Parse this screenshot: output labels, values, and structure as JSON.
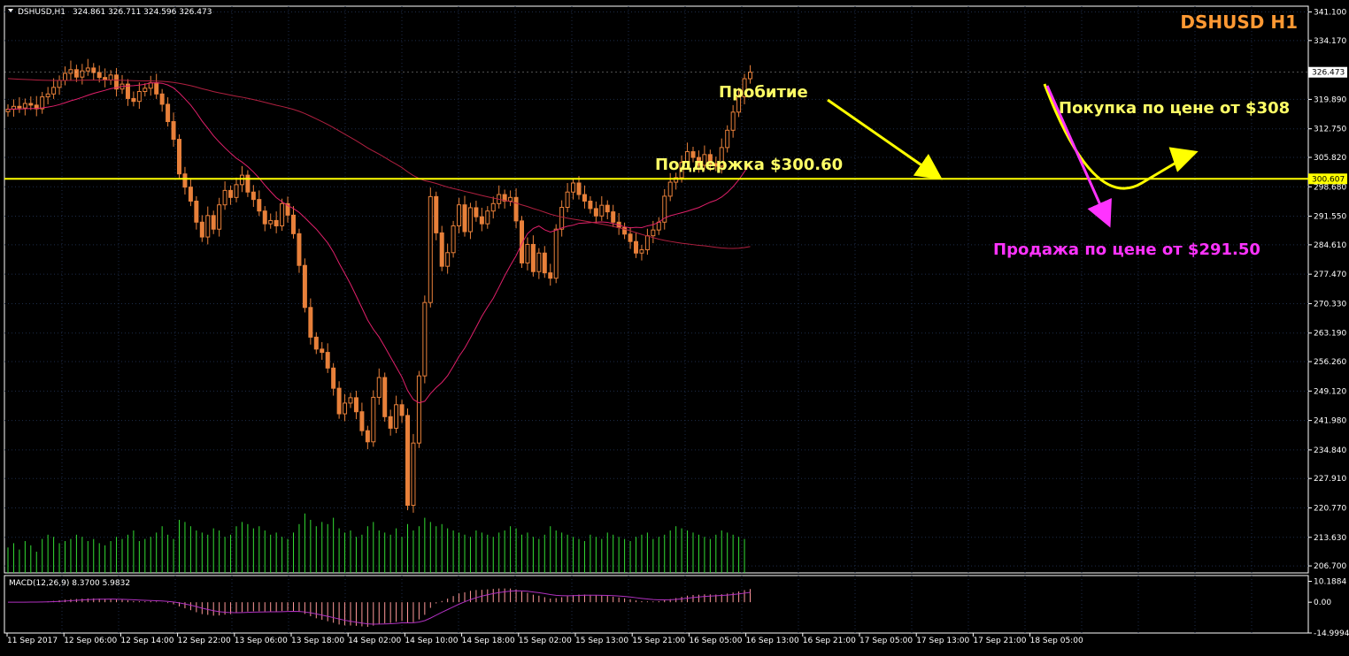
{
  "header": {
    "symbol_caption": "DSHUSD,H1",
    "ohlc": "324.861 326.711 324.596 326.473",
    "chart_title": "DSHUSD H1"
  },
  "colors": {
    "background": "#000000",
    "frame": "#ffffff",
    "grid": "#1e2d4a",
    "candle": "#e8803a",
    "volume": "#33dd33",
    "ma_fast": "#e0206a",
    "ma_slow": "#b02040",
    "support": "#ffff00",
    "arrow_yellow": "#ffff00",
    "arrow_magenta": "#ff33ff",
    "title": "#ff9933",
    "annotation_yellow": "#ffff66",
    "annotation_magenta": "#ff33ff",
    "price_tag_bg": "#ffff00",
    "macd_line": "#b030c0",
    "macd_hist": "#ff9999"
  },
  "annotations": {
    "breakout": "Пробитие",
    "support": "Поддержка $300.60",
    "buy": "Покупка по цене от $308",
    "sell": "Продажа по цене от $291.50"
  },
  "macd": {
    "caption": "MACD(12,26,9) 8.3700 5.9832",
    "ticks": [
      "10.1884",
      "0.00",
      "-14.9994"
    ],
    "range": [
      -14.9994,
      13
    ]
  },
  "chart_data": {
    "type": "candlestick",
    "title": "DSHUSD H1",
    "ylim": [
      205.0,
      342.5
    ],
    "y_ticks": [
      "341.100",
      "334.170",
      "326.473",
      "319.890",
      "312.750",
      "305.820",
      "300.607",
      "298.680",
      "291.550",
      "284.610",
      "277.470",
      "270.330",
      "263.190",
      "256.260",
      "249.120",
      "241.980",
      "234.840",
      "227.910",
      "220.770",
      "213.630",
      "206.700"
    ],
    "current_price": "326.473",
    "support_price": "300.607",
    "x_labels": [
      "11 Sep 2017",
      "12 Sep 06:00",
      "12 Sep 14:00",
      "12 Sep 22:00",
      "13 Sep 06:00",
      "13 Sep 18:00",
      "14 Sep 02:00",
      "14 Sep 10:00",
      "14 Sep 18:00",
      "15 Sep 02:00",
      "15 Sep 13:00",
      "15 Sep 21:00",
      "16 Sep 05:00",
      "16 Sep 13:00",
      "16 Sep 21:00",
      "17 Sep 05:00",
      "17 Sep 13:00",
      "17 Sep 21:00",
      "18 Sep 05:00"
    ],
    "series": [
      {
        "name": "DSHUSD",
        "values": [
          317.5,
          318.2,
          317.8,
          318.9,
          318.5,
          317.6,
          320.5,
          321.2,
          322.8,
          324.5,
          326.2,
          327.1,
          325.3,
          326.8,
          327.5,
          326.4,
          325.2,
          324.6,
          325.8,
          322.4,
          323.6,
          320.1,
          319.4,
          321.8,
          322.6,
          323.9,
          321.2,
          318.7,
          314.5,
          310.2,
          301.8,
          298.6,
          295.2,
          290.1,
          286.5,
          291.7,
          288.4,
          294.3,
          297.8,
          296.1,
          299.2,
          301.5,
          297.4,
          295.6,
          292.8,
          289.7,
          290.5,
          289.2,
          294.6,
          291.8,
          287.3,
          279.6,
          269.4,
          262.2,
          259.3,
          258.5,
          254.7,
          249.8,
          243.6,
          246.2,
          247.5,
          244.1,
          239.5,
          236.8,
          247.6,
          252.4,
          242.9,
          240.1,
          245.8,
          243.2,
          221.4,
          236.5,
          252.8,
          270.6,
          296.3,
          287.5,
          279.4,
          282.7,
          289.2,
          294.3,
          287.8,
          293.6,
          291.4,
          289.7,
          292.8,
          294.6,
          296.8,
          295.2,
          296.1,
          290.4,
          280.2,
          284.7,
          278.1,
          282.6,
          277.8,
          276.5,
          288.4,
          293.7,
          297.4,
          299.6,
          296.8,
          295.2,
          293.4,
          291.6,
          294.2,
          292.6,
          290.1,
          288.8,
          287.2,
          285.4,
          282.6,
          283.4,
          286.8,
          288.2,
          290.1,
          296.4,
          299.8,
          300.9,
          304.6,
          307.2,
          305.8,
          303.9,
          306.5,
          304.3,
          303.7,
          308.2,
          312.4,
          316.8,
          320.5,
          324.9,
          326.473
        ]
      }
    ],
    "volume": [
      12,
      14,
      11,
      15,
      13,
      10,
      16,
      18,
      17,
      14,
      15,
      16,
      18,
      17,
      15,
      16,
      14,
      13,
      15,
      17,
      16,
      18,
      20,
      15,
      16,
      17,
      19,
      22,
      18,
      16,
      25,
      24,
      22,
      20,
      19,
      18,
      21,
      20,
      17,
      18,
      22,
      24,
      23,
      21,
      22,
      20,
      18,
      19,
      17,
      16,
      19,
      23,
      28,
      25,
      22,
      24,
      23,
      26,
      21,
      19,
      20,
      17,
      18,
      22,
      24,
      20,
      19,
      18,
      21,
      17,
      23,
      20,
      22,
      26,
      24,
      22,
      23,
      21,
      20,
      19,
      18,
      17,
      20,
      19,
      18,
      17,
      19,
      20,
      22,
      21,
      18,
      19,
      17,
      16,
      18,
      22,
      20,
      19,
      18,
      17,
      16,
      15,
      18,
      17,
      16,
      19,
      18,
      17,
      16,
      15,
      17,
      18,
      19,
      16,
      17,
      18,
      20,
      22,
      21,
      20,
      19,
      18,
      17,
      16,
      18,
      20,
      19,
      18,
      17,
      16
    ]
  }
}
